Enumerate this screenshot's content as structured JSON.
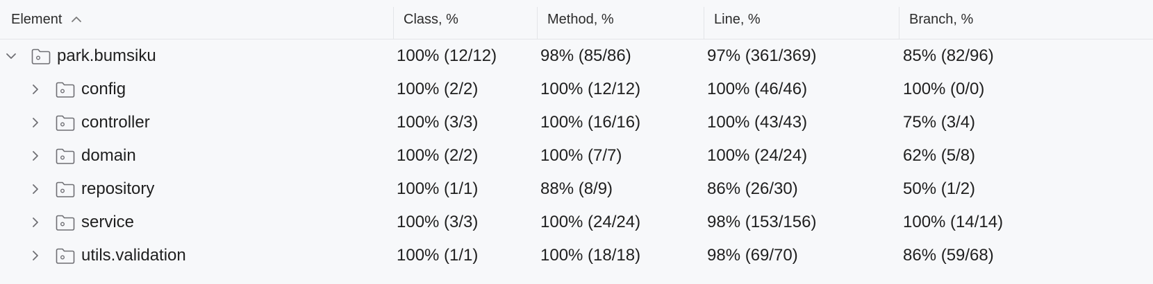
{
  "header": {
    "element": "Element",
    "class": "Class, %",
    "method": "Method, %",
    "line": "Line, %",
    "branch": "Branch, %"
  },
  "icons": {
    "sort": "chevron-up-icon",
    "expanded": "chevron-down-icon",
    "collapsed": "chevron-right-icon",
    "package": "package-folder-icon"
  },
  "colors": {
    "background": "#f7f8fa",
    "text": "#1f1f1f",
    "icon": "#6e6e73"
  },
  "rows": [
    {
      "name": "park.bumsiku",
      "class": "100% (12/12)",
      "method": "98% (85/86)",
      "line": "97% (361/369)",
      "branch": "85% (82/96)"
    },
    {
      "name": "config",
      "class": "100% (2/2)",
      "method": "100% (12/12)",
      "line": "100% (46/46)",
      "branch": "100% (0/0)"
    },
    {
      "name": "controller",
      "class": "100% (3/3)",
      "method": "100% (16/16)",
      "line": "100% (43/43)",
      "branch": "75% (3/4)"
    },
    {
      "name": "domain",
      "class": "100% (2/2)",
      "method": "100% (7/7)",
      "line": "100% (24/24)",
      "branch": "62% (5/8)"
    },
    {
      "name": "repository",
      "class": "100% (1/1)",
      "method": "88% (8/9)",
      "line": "86% (26/30)",
      "branch": "50% (1/2)"
    },
    {
      "name": "service",
      "class": "100% (3/3)",
      "method": "100% (24/24)",
      "line": "98% (153/156)",
      "branch": "100% (14/14)"
    },
    {
      "name": "utils.validation",
      "class": "100% (1/1)",
      "method": "100% (18/18)",
      "line": "98% (69/70)",
      "branch": "86% (59/68)"
    }
  ]
}
